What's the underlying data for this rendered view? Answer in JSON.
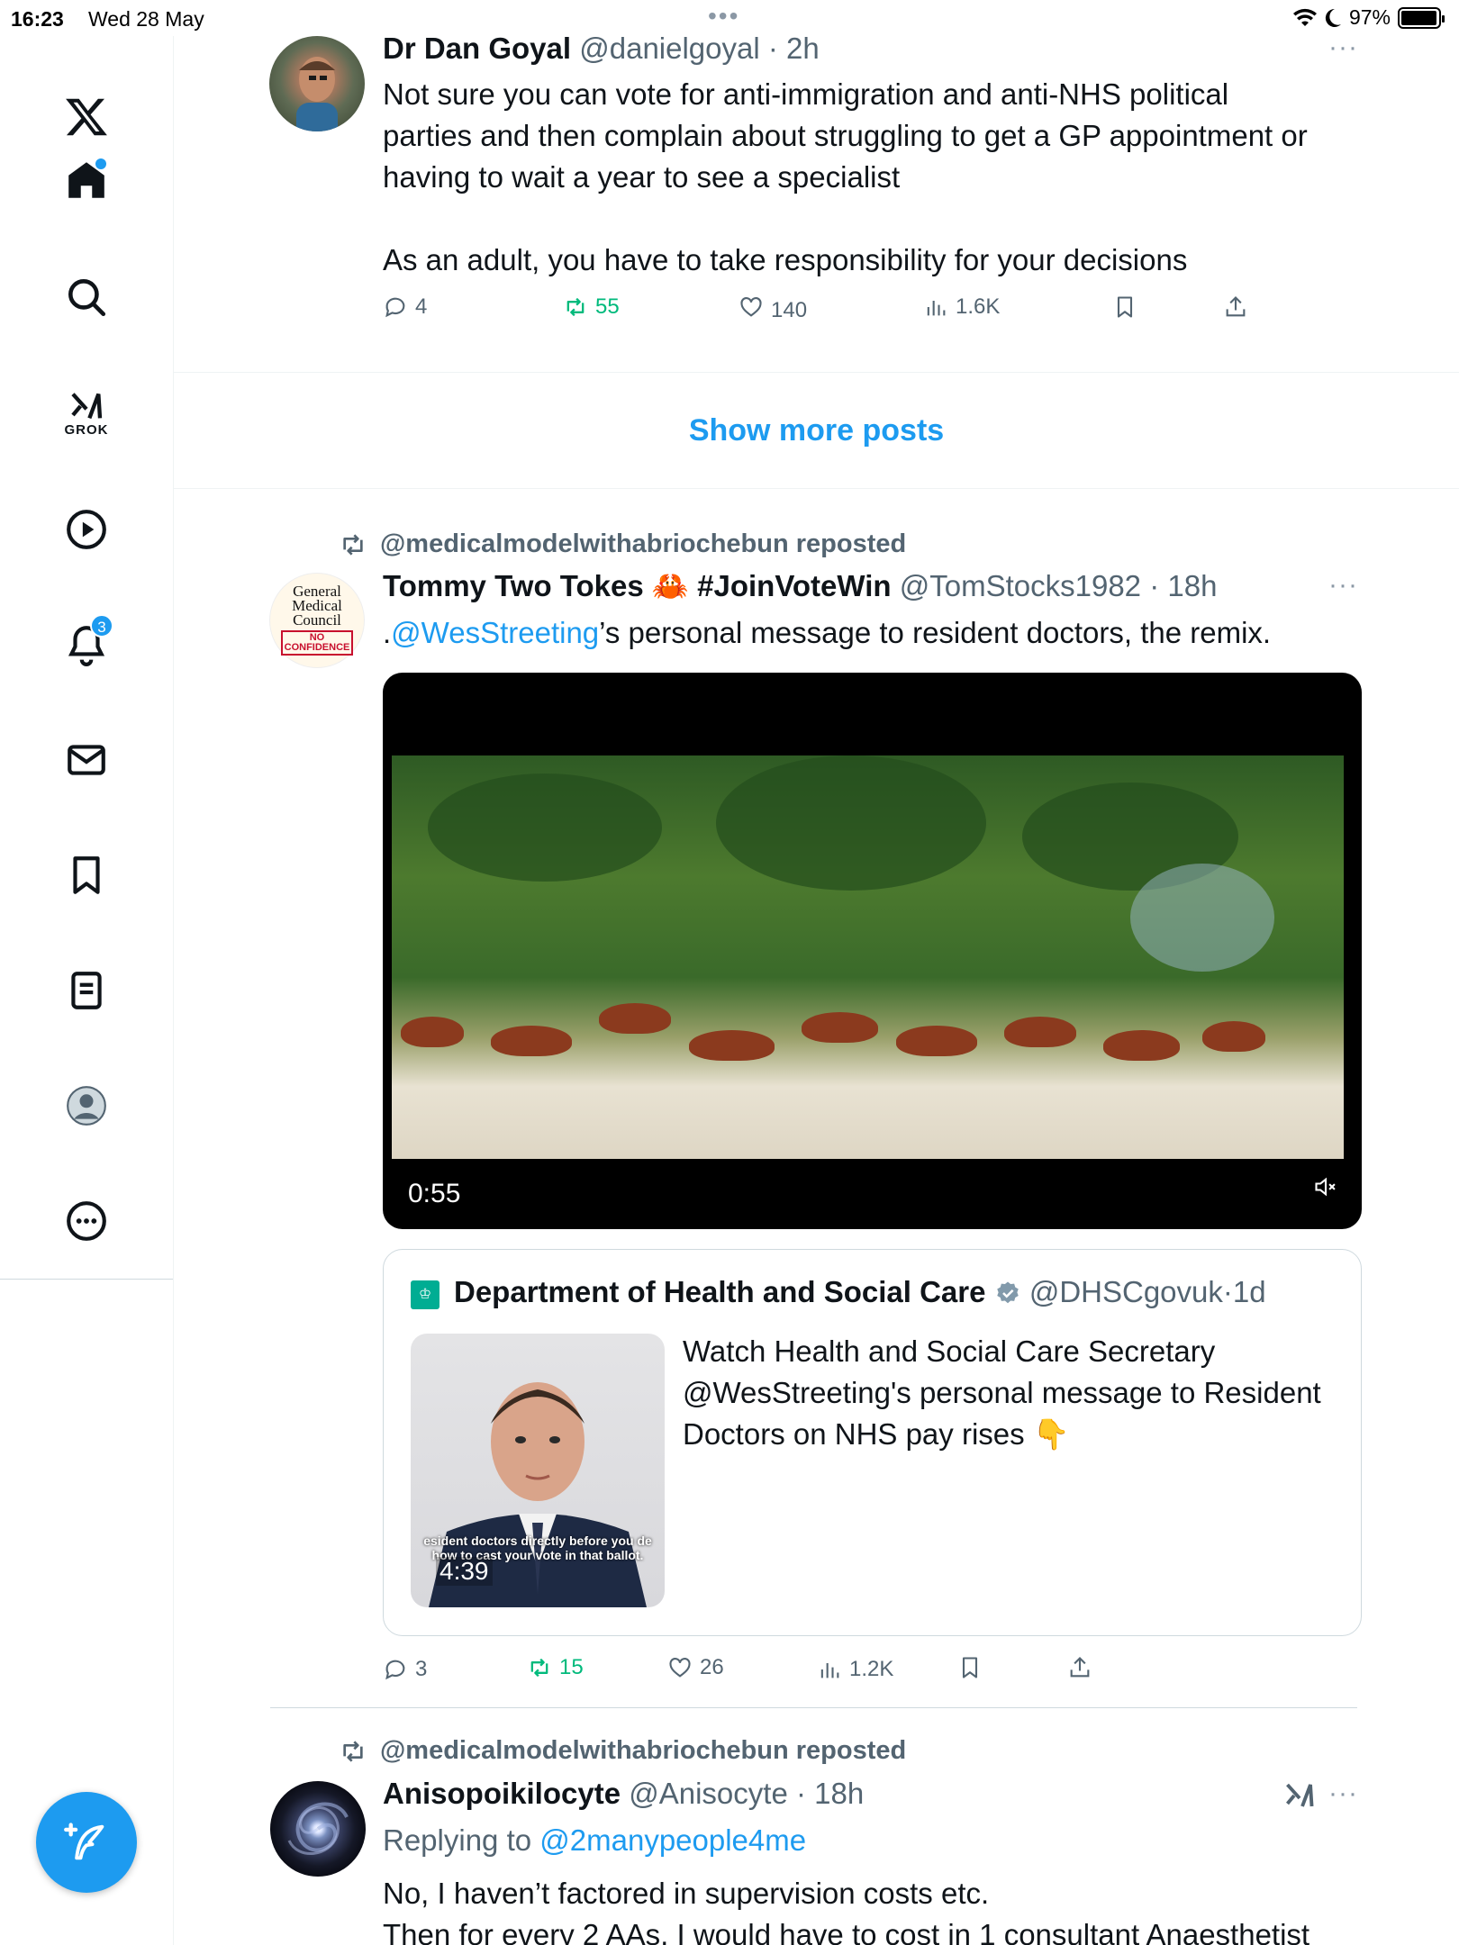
{
  "status_bar": {
    "time": "16:23",
    "date": "Wed 28 May",
    "battery": "97%",
    "battery_level": 0.97
  },
  "sidebar": {
    "items": [
      {
        "name": "x-logo-icon"
      },
      {
        "name": "home-icon",
        "has_dot": true
      },
      {
        "name": "search-icon"
      },
      {
        "name": "grok-icon",
        "label": "GROK"
      },
      {
        "name": "play-icon"
      },
      {
        "name": "notifications-icon",
        "badge": "3"
      },
      {
        "name": "messages-icon"
      },
      {
        "name": "bookmarks-icon"
      },
      {
        "name": "lists-icon"
      },
      {
        "name": "profile-icon"
      },
      {
        "name": "more-icon"
      }
    ],
    "compose_icon": "compose-quill-icon"
  },
  "colors": {
    "accent": "#1d9bf0",
    "repost_green": "#00ba7c",
    "secondary_text": "#536471"
  },
  "post1": {
    "name": "Dr Dan Goyal",
    "handle": "@danielgoyal",
    "time": "2h",
    "text_line1": "Not sure you can vote for anti-immigration and anti-NHS political",
    "text_line2": "parties and then complain about struggling to get a GP appointment or",
    "text_line3": "having to wait a year to see a specialist",
    "text_line4": "As an adult, you have to take responsibility for your decisions",
    "replies": "4",
    "reposts": "55",
    "likes": "140",
    "views": "1.6K"
  },
  "show_more": "Show more posts",
  "post2": {
    "reposted_by": "@medicalmodelwithabriochebun reposted",
    "name": "Tommy Two Tokes",
    "emoji": "🦀",
    "hashtag": "#JoinVoteWin",
    "handle": "@TomStocks1982",
    "time": "18h",
    "text_prefix": ".",
    "mention": "@WesStreeting",
    "text_suffix": "’s personal message to resident doctors, the remix.",
    "avatar_text_1": "General",
    "avatar_text_2": "Medical",
    "avatar_text_3": "Council",
    "avatar_stamp_1": "NO",
    "avatar_stamp_2": "CONFIDENCE",
    "video_duration": "0:55",
    "quote": {
      "name": "Department of Health and Social Care",
      "handle": "@DHSCgovuk",
      "time": "1d",
      "text": "Watch Health and Social Care Secretary @WesStreeting's personal message to Resident Doctors on NHS pay rises 👇",
      "thumb_duration": "4:39",
      "thumb_caption_1": "esident doctors directly before you de",
      "thumb_caption_2": "how to cast your vote in that ballot."
    },
    "replies": "3",
    "reposts": "15",
    "likes": "26",
    "views": "1.2K"
  },
  "post3": {
    "reposted_by": "@medicalmodelwithabriochebun reposted",
    "name": "Anisopoikilocyte",
    "handle": "@Anisocyte",
    "time": "18h",
    "replying_prefix": "Replying to ",
    "replying_to": "@2manypeople4me",
    "text_line1": "No, I haven’t factored in supervision costs etc.",
    "text_line2": "Then for every 2 AAs, I would have to cost in 1 consultant Anaesthetist"
  }
}
